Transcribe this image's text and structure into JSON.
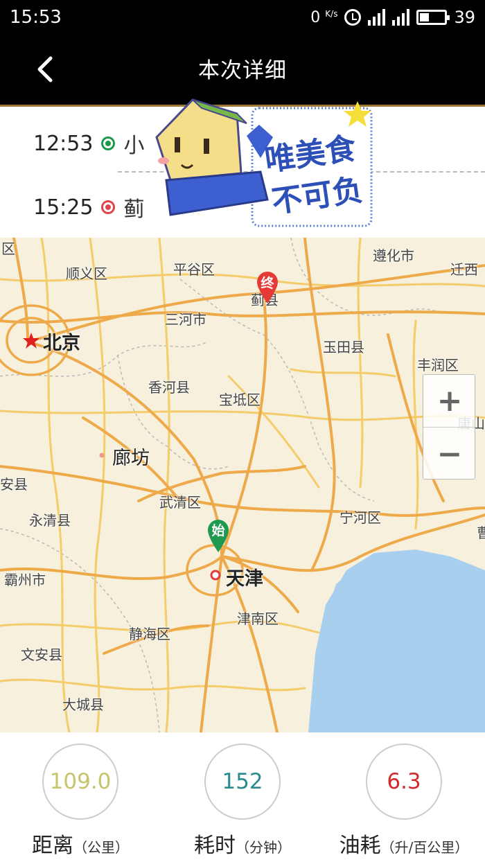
{
  "status_bar": {
    "time": "15:53",
    "net_speed": "0",
    "net_unit": "K/s",
    "battery": "39"
  },
  "header": {
    "back_icon": "chevron-left-icon",
    "title": "本次详细"
  },
  "trip": {
    "start": {
      "time": "12:53",
      "place": "小"
    },
    "end": {
      "time": "15:25",
      "place": "蓟"
    }
  },
  "sticker": {
    "text_line1": "唯美食",
    "text_line2": "不可负"
  },
  "map": {
    "labels": {
      "shunyi": "顺义区",
      "pinggu": "平谷区",
      "zunhua": "遵化市",
      "qianxi": "迁西",
      "jixian": "蓟县",
      "sanhe": "三河市",
      "beijing": "北京",
      "yutian": "玉田县",
      "fengrun": "丰润区",
      "xianghe": "香河县",
      "baodi": "宝坻区",
      "tang": "唐山",
      "langfang": "廊坊",
      "anxian": "安县",
      "wuqing": "武清区",
      "yongqing": "永清县",
      "ninghe": "宁河区",
      "tianjin": "天津",
      "bazhou": "霸州市",
      "jinnan": "津南区",
      "jinghai": "静海区",
      "wenan": "文安县",
      "dacheng": "大城县",
      "qu": "区",
      "cao": "曹"
    },
    "start_pin_label": "始",
    "end_pin_label": "终",
    "zoom_in": "+",
    "zoom_out": "−"
  },
  "stats": {
    "distance": {
      "value": "109.0",
      "label": "距离",
      "unit": "（公里）",
      "color": "#c7c46a"
    },
    "duration": {
      "value": "152",
      "label": "耗时",
      "unit": "（分钟）",
      "color": "#2a8a8c"
    },
    "fuel": {
      "value": "6.3",
      "label": "油耗",
      "unit": "（升/百公里）",
      "color": "#d02a2a"
    }
  }
}
